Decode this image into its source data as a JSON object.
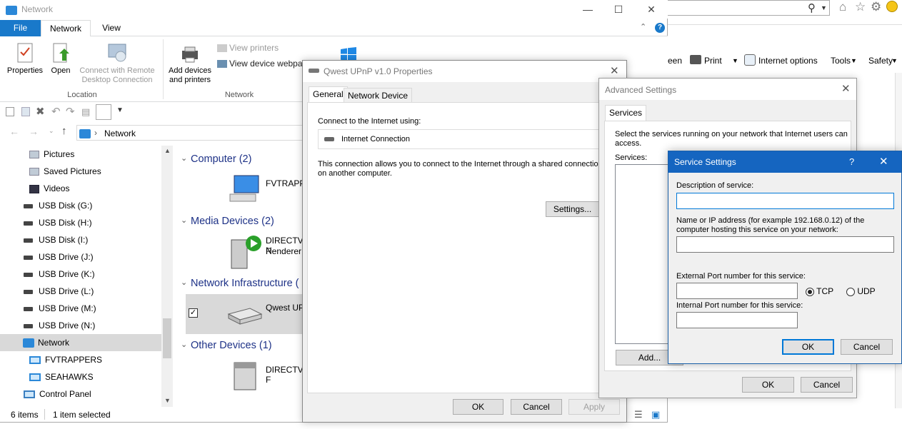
{
  "explorer": {
    "title": "Network",
    "tabs": {
      "file": "File",
      "network": "Network",
      "view": "View"
    },
    "ribbon": {
      "properties": "Properties",
      "open": "Open",
      "connect_remote_1": "Connect with Remote",
      "connect_remote_2": "Desktop Connection",
      "location_group": "Location",
      "add_devices_1": "Add devices",
      "add_devices_2": "and printers",
      "view_printers": "View printers",
      "view_device_webpage": "View device webpag",
      "network_group": "Network"
    },
    "address": {
      "location": "Network"
    },
    "nav_items": [
      {
        "label": "Pictures"
      },
      {
        "label": "Saved Pictures"
      },
      {
        "label": "Videos"
      },
      {
        "label": "USB Disk (G:)"
      },
      {
        "label": "USB Disk (H:)"
      },
      {
        "label": "USB Disk (I:)"
      },
      {
        "label": "USB Drive (J:)"
      },
      {
        "label": "USB Drive (K:)"
      },
      {
        "label": "USB Drive (L:)"
      },
      {
        "label": "USB Drive (M:)"
      },
      {
        "label": "USB Drive (N:)"
      },
      {
        "label": "Network"
      },
      {
        "label": "FVTRAPPERS"
      },
      {
        "label": "SEAHAWKS"
      },
      {
        "label": "Control Panel"
      }
    ],
    "groups": {
      "computer": "Computer (2)",
      "computer_item": "FVTRAPPE",
      "media": "Media Devices (2)",
      "media_item_1": "DIRECTV N",
      "media_item_2": "Renderer",
      "infra": "Network Infrastructure (",
      "infra_item": "Qwest UP",
      "other": "Other Devices (1)",
      "other_item": "DIRECTV F"
    },
    "status": {
      "items": "6 items",
      "selected": "1 item selected"
    }
  },
  "browser": {
    "toolbar": {
      "screen": "een",
      "print": "Print",
      "internet_options": "Internet options",
      "tools": "Tools",
      "safety": "Safety"
    }
  },
  "qwest_dialog": {
    "title": "Qwest UPnP v1.0 Properties",
    "tabs": {
      "general": "General",
      "network_device": "Network Device"
    },
    "connect_label": "Connect to the Internet using:",
    "connection_name": "Internet Connection",
    "description_1": "This connection allows you to connect to the Internet through a shared connection",
    "description_2": "on another computer.",
    "settings_button": "Settings...",
    "ok": "OK",
    "cancel": "Cancel",
    "apply": "Apply"
  },
  "advanced_dialog": {
    "title": "Advanced Settings",
    "tab": "Services",
    "intro_1": "Select the services running on your network that Internet users can",
    "intro_2": "access.",
    "services_label": "Services:",
    "add_button": "Add...",
    "ok": "OK",
    "cancel": "Cancel"
  },
  "service_dialog": {
    "title": "Service Settings",
    "help": "?",
    "description_label": "Description of service:",
    "description_value": "",
    "host_label_1": "Name or IP address (for example 192.168.0.12) of the",
    "host_label_2": "computer hosting this service on your network:",
    "host_value": "",
    "external_port_label": "External Port number for this service:",
    "external_port_value": "",
    "internal_port_label": "Internal Port number for this service:",
    "internal_port_value": "",
    "tcp": "TCP",
    "udp": "UDP",
    "ok": "OK",
    "cancel": "Cancel"
  },
  "colors": {
    "accent": "#0078d7",
    "title_blue": "#1565c0",
    "group_header": "#1e3287"
  }
}
